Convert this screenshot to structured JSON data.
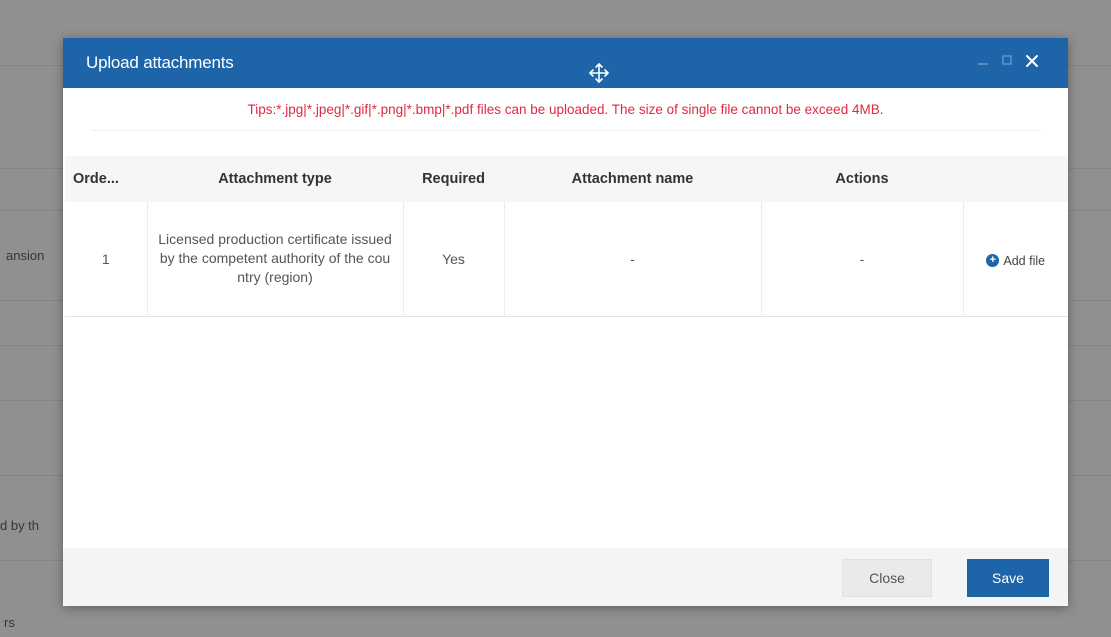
{
  "background": {
    "fragments": [
      "ansion",
      "d by th",
      "rs"
    ]
  },
  "dialog": {
    "title": "Upload attachments",
    "tips": "Tips:*.jpg|*.jpeg|*.gif|*.png|*.bmp|*.pdf files can be uploaded. The size of single file cannot be exceed 4MB.",
    "icons": {
      "move": "move-icon",
      "close": "close-icon",
      "minimize": "minimize-icon",
      "maximize": "maximize-icon"
    },
    "table": {
      "headers": {
        "order": "Orde...",
        "type": "Attachment type",
        "required": "Required",
        "name": "Attachment name",
        "actions": "Actions"
      },
      "rows": [
        {
          "order": "1",
          "type": "Licensed production certificate issued by the competent authority of the country (region)",
          "required": "Yes",
          "name": "-",
          "actions": "-",
          "add_label": "Add file"
        }
      ]
    },
    "footer": {
      "close_label": "Close",
      "save_label": "Save"
    }
  },
  "colors": {
    "header": "#1d64a8",
    "tips": "#e0293f",
    "save_button": "#1d64a8"
  }
}
